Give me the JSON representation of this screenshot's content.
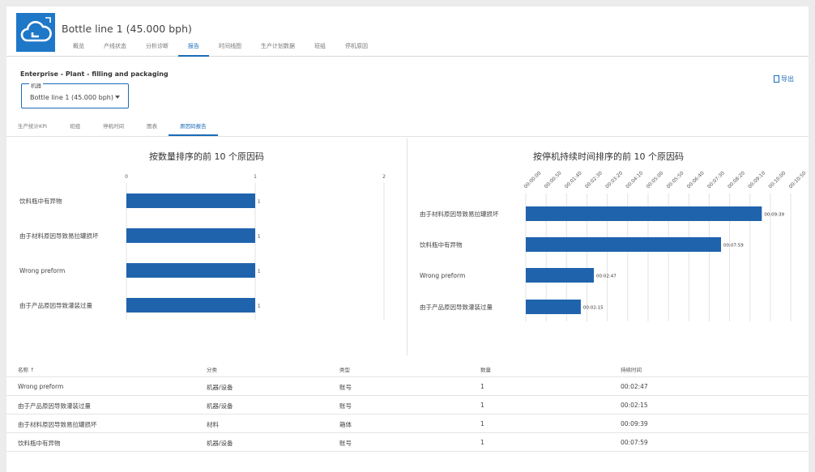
{
  "header": {
    "title": "Bottle line 1 (45.000 bph)",
    "nav": [
      "概览",
      "产线状态",
      "分析诊断",
      "报告",
      "时间线图",
      "生产计划数据",
      "班组",
      "停机原因"
    ],
    "active_nav": 3
  },
  "breadcrumb": "Enterprise - Plant - filling and packaging",
  "machine": {
    "label": "机器",
    "value": "Bottle line 1 (45.000 bph)"
  },
  "export_label": "导出",
  "tabs": [
    "生产统计KPI",
    "班组",
    "停机时间",
    "图表",
    "原因码报告"
  ],
  "active_tab": 4,
  "colors": {
    "accent": "#1b6bb8",
    "bar": "#1f63ad"
  },
  "chart_data": [
    {
      "type": "bar",
      "orientation": "horizontal",
      "title": "按数量排序的前 10 个原因码",
      "categories": [
        "饮料瓶中有异物",
        "由于材料原因导致易拉罐损坏",
        "Wrong preform",
        "由于产品原因导致灌装过量"
      ],
      "values": [
        1,
        1,
        1,
        1
      ],
      "data_labels": [
        "1",
        "1",
        "1",
        "1"
      ],
      "xlim": [
        0,
        2
      ],
      "x_ticks": [
        "0",
        "1",
        "2"
      ],
      "grid": true
    },
    {
      "type": "bar",
      "orientation": "horizontal",
      "title": "按停机持续时间排序的前 10 个原因码",
      "categories": [
        "由于材料原因导致易拉罐损坏",
        "饮料瓶中有异物",
        "Wrong preform",
        "由于产品原因导致灌装过量"
      ],
      "values": [
        579,
        479,
        167,
        135
      ],
      "data_labels": [
        "00:09:39",
        "00:07:59",
        "00:02:47",
        "00:02:15"
      ],
      "xlim": [
        0,
        630
      ],
      "x_ticks": [
        "00:00:00",
        "00:00:50",
        "00:01:40",
        "00:02:30",
        "00:03:20",
        "00:04:10",
        "00:05:00",
        "00:05:50",
        "00:06:40",
        "00:07:30",
        "00:08:20",
        "00:09:10",
        "00:10:00",
        "00:10:50"
      ],
      "grid": true
    }
  ],
  "table": {
    "columns": [
      "名称 ↑",
      "分类",
      "类型",
      "数量",
      "持续时间"
    ],
    "rows": [
      [
        "Wrong preform",
        "机器/设备",
        "账号",
        "1",
        "00:02:47"
      ],
      [
        "由于产品原因导致灌装过量",
        "机器/设备",
        "账号",
        "1",
        "00:02:15"
      ],
      [
        "由于材料原因导致易拉罐损坏",
        "材料",
        "箱体",
        "1",
        "00:09:39"
      ],
      [
        "饮料瓶中有异物",
        "机器/设备",
        "账号",
        "1",
        "00:07:59"
      ]
    ]
  }
}
